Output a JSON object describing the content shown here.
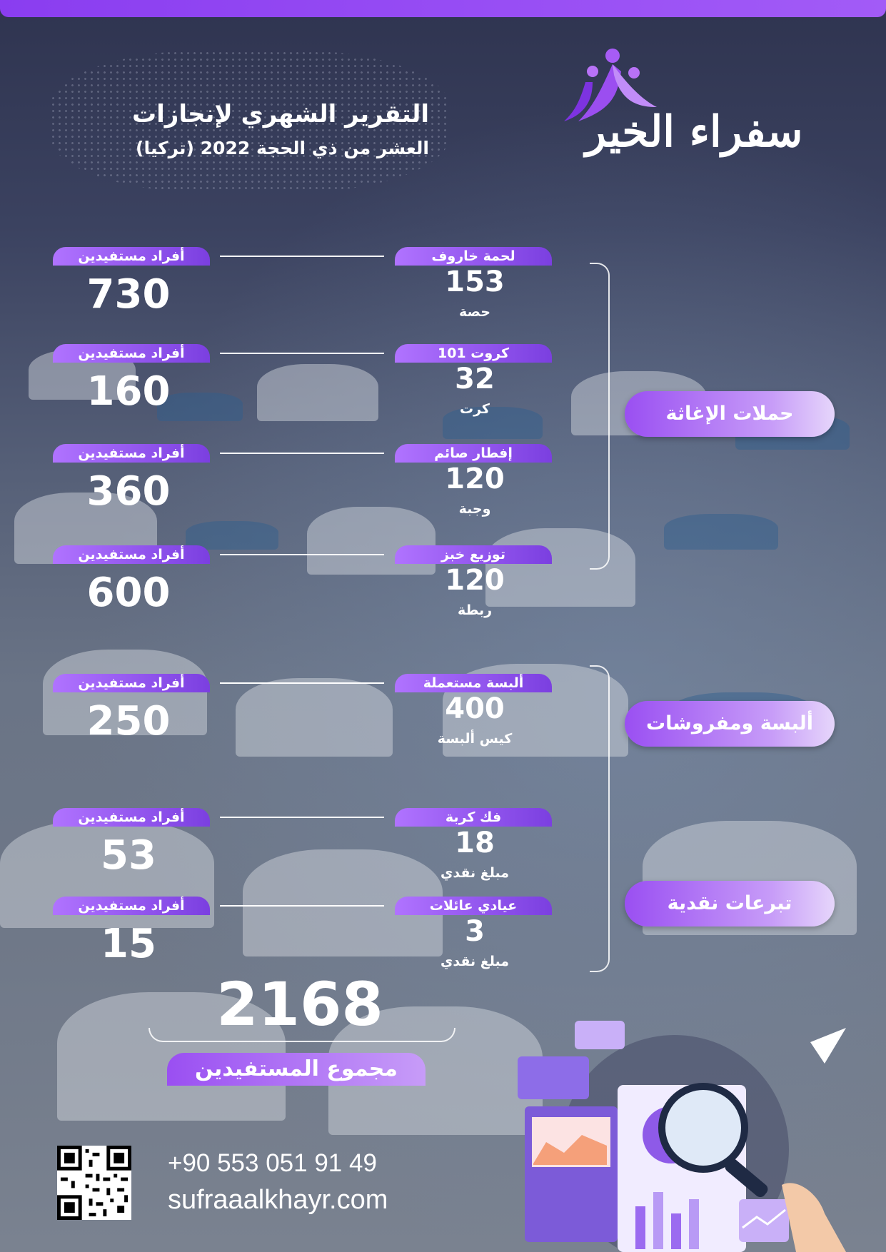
{
  "header": {
    "title": "التقرير الشهري لإنجازات",
    "subtitle": "العشر من ذي الحجة 2022 (تركيا)"
  },
  "logo": {
    "text": "سفراء الخير"
  },
  "beneficiaries_label": "أفراد مستفيدين",
  "categories": [
    {
      "label": "حملات الإغاثة"
    },
    {
      "label": "ألبسة ومفروشات"
    },
    {
      "label": "تبرعات نقدية"
    }
  ],
  "items": [
    {
      "name": "لحمة خاروف",
      "quantity": "153",
      "unit": "حصة",
      "beneficiaries": "730"
    },
    {
      "name": "كروت 101",
      "quantity": "32",
      "unit": "كرت",
      "beneficiaries": "160"
    },
    {
      "name": "إفطار صائم",
      "quantity": "120",
      "unit": "وجبة",
      "beneficiaries": "360"
    },
    {
      "name": "توزيع خبز",
      "quantity": "120",
      "unit": "ربطة",
      "beneficiaries": "600"
    },
    {
      "name": "ألبسة مستعملة",
      "quantity": "400",
      "unit": "كيس ألبسة",
      "beneficiaries": "250"
    },
    {
      "name": "فك كربة",
      "quantity": "18",
      "unit": "مبلغ نقدي",
      "beneficiaries": "53"
    },
    {
      "name": "عيادي عائلات",
      "quantity": "3",
      "unit": "مبلغ نقدي",
      "beneficiaries": "15"
    }
  ],
  "total": {
    "value": "2168",
    "label": "مجموع المستفيدين"
  },
  "contact": {
    "phone": "+90 553 051 91 49",
    "website": "sufraaalkhayr.com"
  },
  "colors": {
    "accent": "#8a3df0",
    "accent_light": "#c79cf8",
    "text": "#ffffff"
  }
}
